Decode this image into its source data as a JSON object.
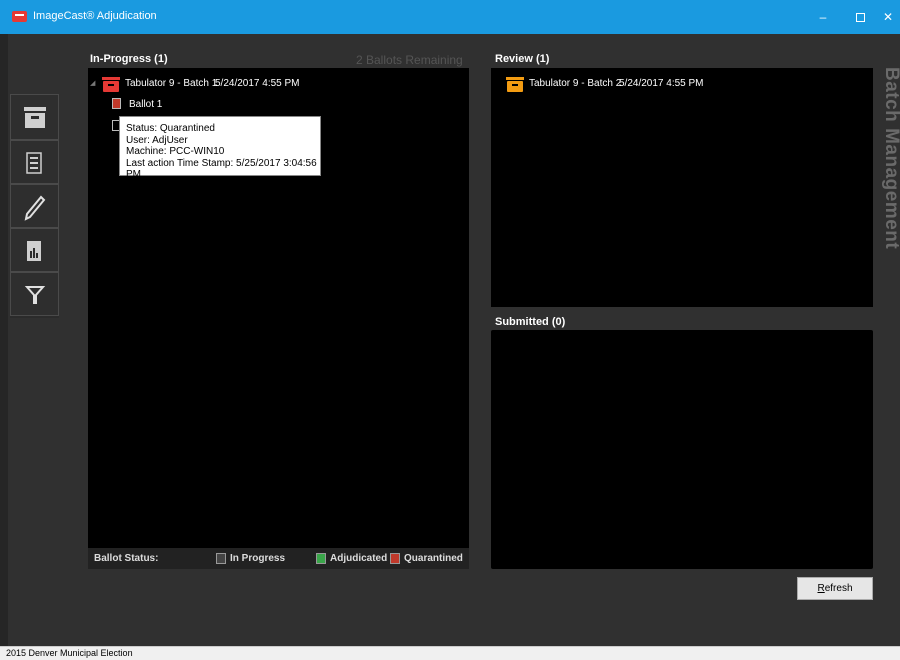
{
  "window": {
    "title": "ImageCast® Adjudication",
    "minimize_glyph": "–",
    "close_glyph": "✕"
  },
  "toolbar": {
    "items": [
      {
        "name": "batch-management",
        "icon": "box-icon"
      },
      {
        "name": "ballot-list",
        "icon": "list-icon"
      },
      {
        "name": "adjudicate",
        "icon": "pencil-icon"
      },
      {
        "name": "reports",
        "icon": "report-icon"
      },
      {
        "name": "filter",
        "icon": "filter-icon"
      }
    ]
  },
  "in_progress": {
    "title": "In-Progress (1)",
    "remaining": "2 Ballots Remaining",
    "batch": {
      "label": "Tabulator 9 - Batch 1",
      "timestamp": "5/24/2017 4:55 PM"
    },
    "ballots": [
      {
        "label": "Ballot 1",
        "status": "quarantined"
      },
      {
        "label": "",
        "status": "in-progress"
      }
    ],
    "tooltip": {
      "status": "Status: Quarantined",
      "user": "User: AdjUser",
      "machine": "Machine: PCC-WIN10",
      "last_action": "Last action Time Stamp: 5/25/2017 3:04:56 PM"
    },
    "legend": {
      "label": "Ballot Status:",
      "in_progress": "In Progress",
      "adjudicated": "Adjudicated",
      "quarantined": "Quarantined"
    }
  },
  "review": {
    "title": "Review (1)",
    "batch": {
      "label": "Tabulator 9 - Batch 2",
      "timestamp": "5/24/2017 4:55 PM"
    }
  },
  "submitted": {
    "title": "Submitted (0)"
  },
  "watermark": "Batch Management",
  "refresh_label": "Refresh",
  "status_bar": "2015 Denver Municipal Election",
  "colors": {
    "title_bar": "#1a9ae0",
    "quarantined": "#c0392b",
    "adjudicated": "#3aa64a",
    "review_batch": "#f39c12",
    "in_progress_batch": "#e53935"
  }
}
